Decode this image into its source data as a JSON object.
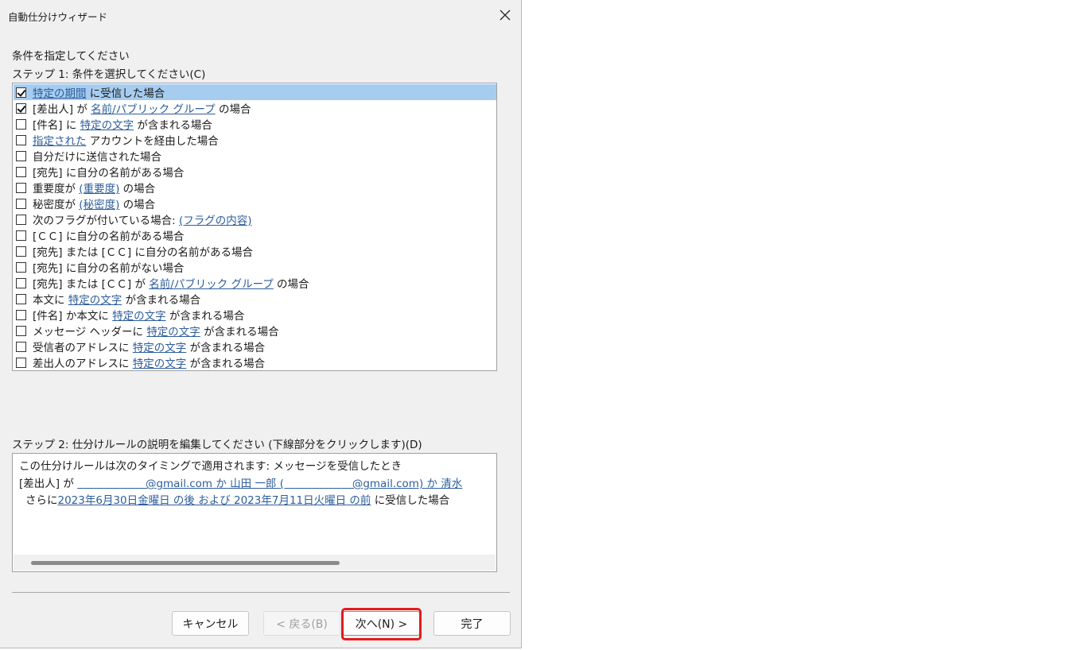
{
  "window": {
    "title": "自動仕分けウィザード"
  },
  "heading": "条件を指定してください",
  "step1_label": "ステップ 1: 条件を選択してください(C)",
  "conditions": [
    {
      "checked": true,
      "selected": true,
      "parts": [
        {
          "t": "特定の期間",
          "link": true
        },
        {
          "t": " に受信した場合"
        }
      ]
    },
    {
      "checked": true,
      "selected": false,
      "parts": [
        {
          "t": "[差出人] が "
        },
        {
          "t": "名前/パブリック グループ",
          "link": true
        },
        {
          "t": " の場合"
        }
      ]
    },
    {
      "checked": false,
      "selected": false,
      "parts": [
        {
          "t": "[件名] に "
        },
        {
          "t": "特定の文字",
          "link": true
        },
        {
          "t": " が含まれる場合"
        }
      ]
    },
    {
      "checked": false,
      "selected": false,
      "parts": [
        {
          "t": "指定された",
          "link": true
        },
        {
          "t": " アカウントを経由した場合"
        }
      ]
    },
    {
      "checked": false,
      "selected": false,
      "parts": [
        {
          "t": "自分だけに送信された場合"
        }
      ]
    },
    {
      "checked": false,
      "selected": false,
      "parts": [
        {
          "t": "[宛先] に自分の名前がある場合"
        }
      ]
    },
    {
      "checked": false,
      "selected": false,
      "parts": [
        {
          "t": "重要度が "
        },
        {
          "t": "(重要度)",
          "link": true
        },
        {
          "t": " の場合"
        }
      ]
    },
    {
      "checked": false,
      "selected": false,
      "parts": [
        {
          "t": "秘密度が "
        },
        {
          "t": "(秘密度)",
          "link": true
        },
        {
          "t": " の場合"
        }
      ]
    },
    {
      "checked": false,
      "selected": false,
      "parts": [
        {
          "t": "次のフラグが付いている場合: "
        },
        {
          "t": "(フラグの内容)",
          "link": true
        }
      ]
    },
    {
      "checked": false,
      "selected": false,
      "parts": [
        {
          "t": "[ＣＣ] に自分の名前がある場合"
        }
      ]
    },
    {
      "checked": false,
      "selected": false,
      "parts": [
        {
          "t": "[宛先] または [ＣＣ] に自分の名前がある場合"
        }
      ]
    },
    {
      "checked": false,
      "selected": false,
      "parts": [
        {
          "t": "[宛先] に自分の名前がない場合"
        }
      ]
    },
    {
      "checked": false,
      "selected": false,
      "parts": [
        {
          "t": "[宛先] または [ＣＣ] が "
        },
        {
          "t": "名前/パブリック グループ",
          "link": true
        },
        {
          "t": " の場合"
        }
      ]
    },
    {
      "checked": false,
      "selected": false,
      "parts": [
        {
          "t": "本文に "
        },
        {
          "t": "特定の文字",
          "link": true
        },
        {
          "t": " が含まれる場合"
        }
      ]
    },
    {
      "checked": false,
      "selected": false,
      "parts": [
        {
          "t": "[件名] か本文に "
        },
        {
          "t": "特定の文字",
          "link": true
        },
        {
          "t": " が含まれる場合"
        }
      ]
    },
    {
      "checked": false,
      "selected": false,
      "parts": [
        {
          "t": "メッセージ ヘッダーに "
        },
        {
          "t": "特定の文字",
          "link": true
        },
        {
          "t": " が含まれる場合"
        }
      ]
    },
    {
      "checked": false,
      "selected": false,
      "parts": [
        {
          "t": "受信者のアドレスに "
        },
        {
          "t": "特定の文字",
          "link": true
        },
        {
          "t": " が含まれる場合"
        }
      ]
    },
    {
      "checked": false,
      "selected": false,
      "parts": [
        {
          "t": "差出人のアドレスに "
        },
        {
          "t": "特定の文字",
          "link": true
        },
        {
          "t": " が含まれる場合"
        }
      ]
    }
  ],
  "step2_label": "ステップ 2: 仕分けルールの説明を編集してください (下線部分をクリックします)(D)",
  "description": {
    "line1": "この仕分けルールは次のタイミングで適用されます: メッセージを受信したとき",
    "line2_prefix": "[差出人] が ",
    "line2_link": "                    @gmail.com か 山田 一郎 (                    @gmail.com) か 清水",
    "line3_prefix": "さらに",
    "line3_link": "2023年6月30日金曜日 の後 および 2023年7月11日火曜日 の前",
    "line3_suffix": " に受信した場合"
  },
  "buttons": {
    "cancel": "キャンセル",
    "back": "< 戻る(B)",
    "next": "次へ(N) >",
    "finish": "完了"
  }
}
